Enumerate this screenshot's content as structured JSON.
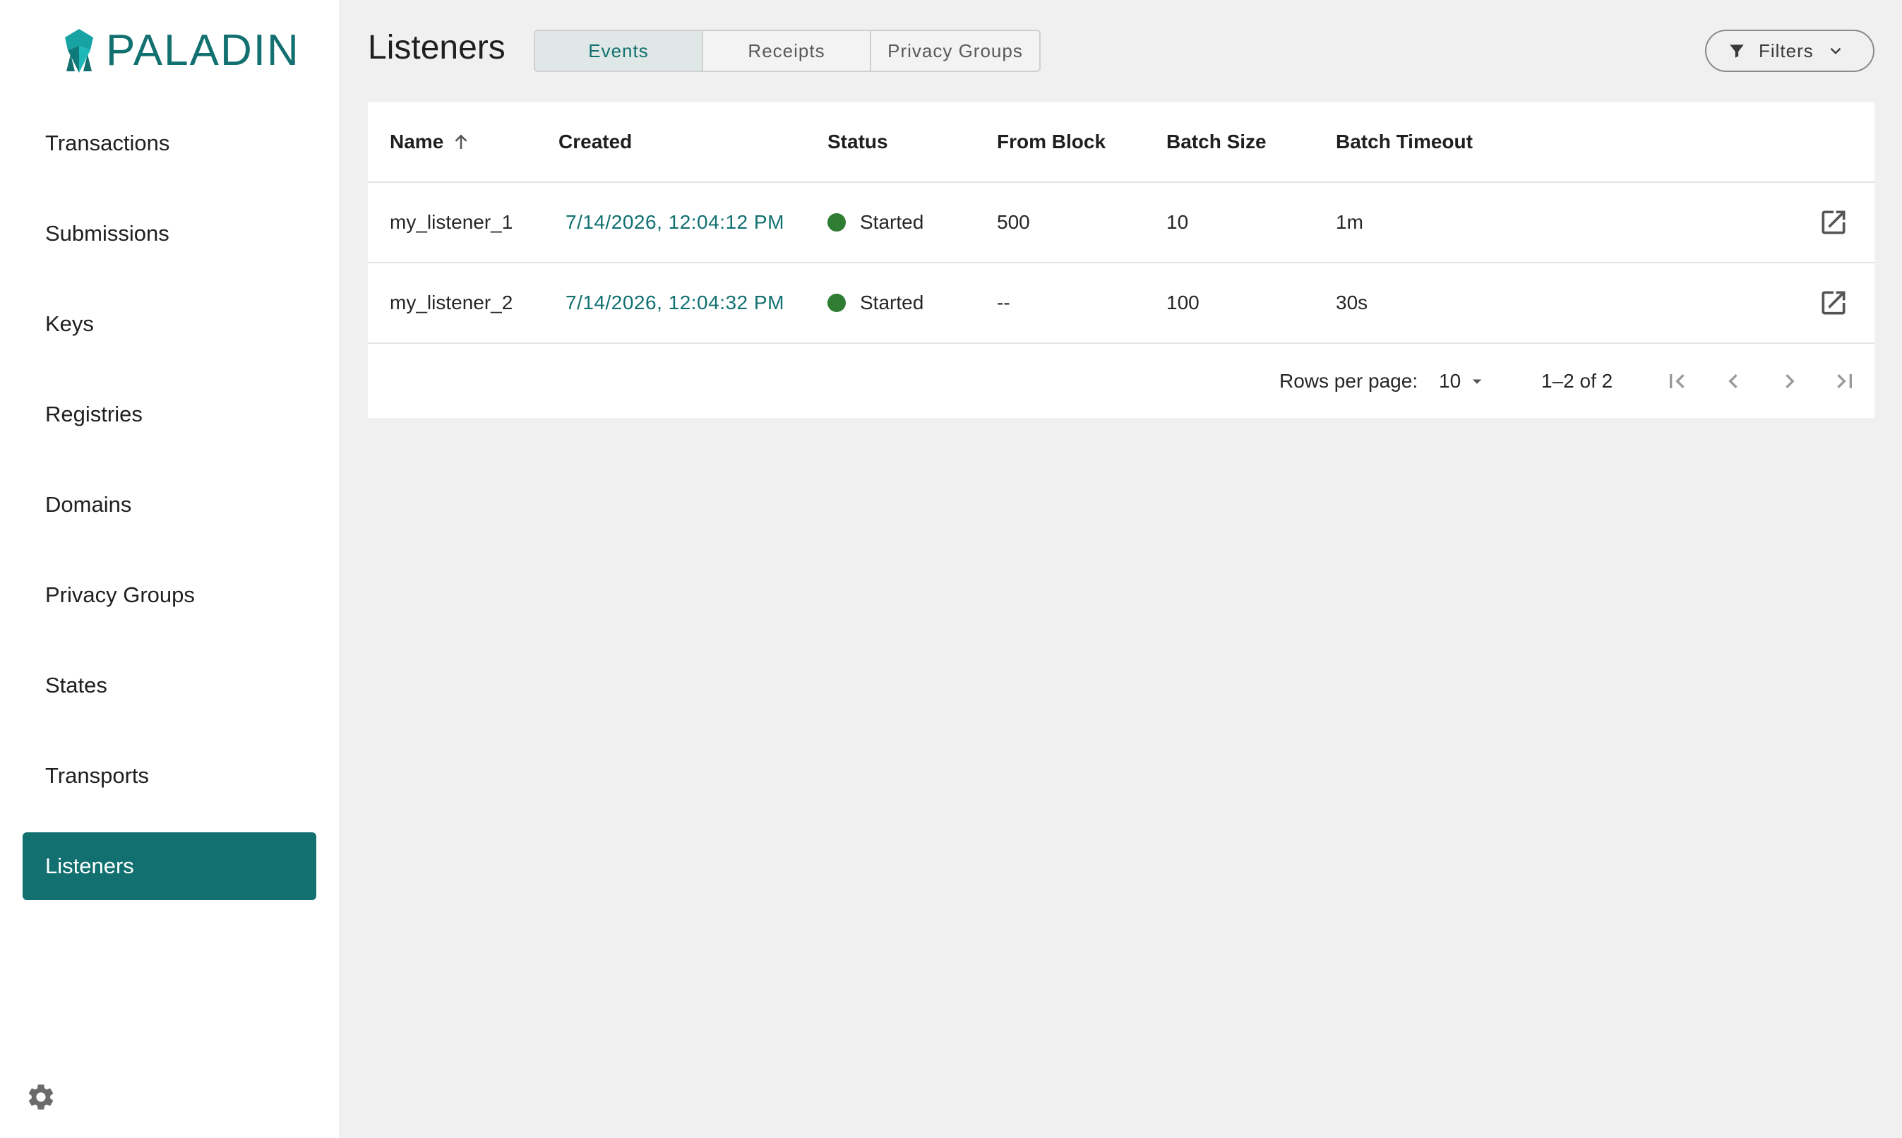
{
  "app": {
    "logo_text": "PALADIN"
  },
  "sidebar": {
    "items": [
      {
        "label": "Transactions"
      },
      {
        "label": "Submissions"
      },
      {
        "label": "Keys"
      },
      {
        "label": "Registries"
      },
      {
        "label": "Domains"
      },
      {
        "label": "Privacy Groups"
      },
      {
        "label": "States"
      },
      {
        "label": "Transports"
      },
      {
        "label": "Listeners",
        "active": true
      }
    ]
  },
  "header": {
    "title": "Listeners",
    "tabs": [
      {
        "label": "Events",
        "active": true
      },
      {
        "label": "Receipts"
      },
      {
        "label": "Privacy Groups"
      }
    ],
    "filters_label": "Filters"
  },
  "table": {
    "columns": [
      "Name",
      "Created",
      "Status",
      "From Block",
      "Batch Size",
      "Batch Timeout"
    ],
    "sort": {
      "column": "Name",
      "direction": "ascending"
    },
    "rows": [
      {
        "name": "my_listener_1",
        "created": "7/14/2026, 12:04:12 PM",
        "status": "Started",
        "from_block": "500",
        "batch_size": "10",
        "batch_timeout": "1m"
      },
      {
        "name": "my_listener_2",
        "created": "7/14/2026, 12:04:32 PM",
        "status": "Started",
        "from_block": "--",
        "batch_size": "100",
        "batch_timeout": "30s"
      }
    ]
  },
  "pagination": {
    "rows_per_page_label": "Rows per page:",
    "rows_per_page": "10",
    "range": "1–2 of 2"
  },
  "colors": {
    "accent": "#127070",
    "status_started": "#2e7d32",
    "background": "#f0f0f0"
  },
  "icons": [
    "logo-icon",
    "sort-ascending-icon",
    "filter-icon",
    "chevron-down-icon",
    "open-in-new-icon",
    "first-page-icon",
    "previous-page-icon",
    "next-page-icon",
    "last-page-icon",
    "settings-gear-icon",
    "dropdown-arrow-icon"
  ]
}
